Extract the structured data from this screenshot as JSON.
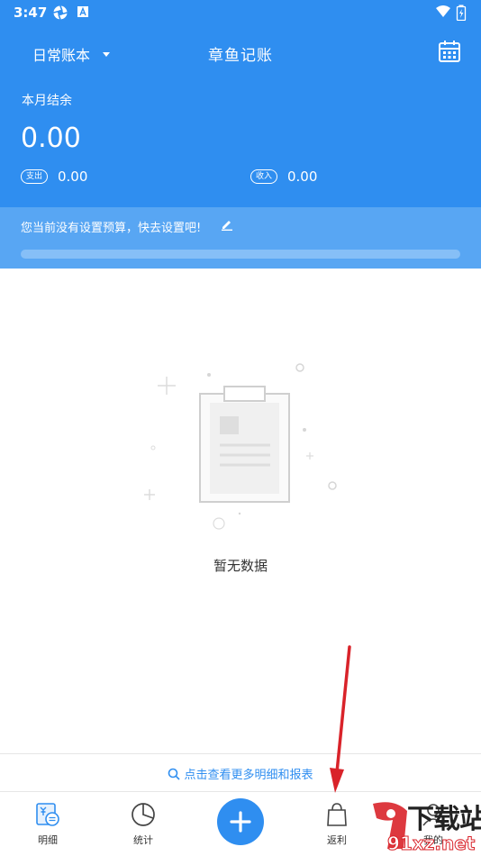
{
  "status_bar": {
    "time": "3:47"
  },
  "header": {
    "book_name": "日常账本",
    "app_title": "章鱼记账"
  },
  "summary": {
    "balance_label": "本月结余",
    "balance_value": "0.00",
    "expense_label": "支出",
    "expense_value": "0.00",
    "income_label": "收入",
    "income_value": "0.00"
  },
  "budget": {
    "prompt": "您当前没有设置预算，快去设置吧!",
    "progress": 0
  },
  "empty_state": {
    "text": "暂无数据"
  },
  "more_link": {
    "label": "点击查看更多明细和报表"
  },
  "bottom_nav": {
    "items": [
      {
        "label": "明细",
        "icon": "ledger-detail-icon"
      },
      {
        "label": "统计",
        "icon": "pie-chart-icon"
      },
      {
        "label": "",
        "icon": "plus-icon"
      },
      {
        "label": "返利",
        "icon": "shopping-bag-icon"
      },
      {
        "label": "我的",
        "icon": "person-icon"
      }
    ]
  },
  "watermark": {
    "text": "下载站",
    "url_text": "91xz.net"
  },
  "colors": {
    "primary": "#2f8ef0",
    "budget_bar": "#58a6f3",
    "annotation_arrow": "#d9232a"
  }
}
